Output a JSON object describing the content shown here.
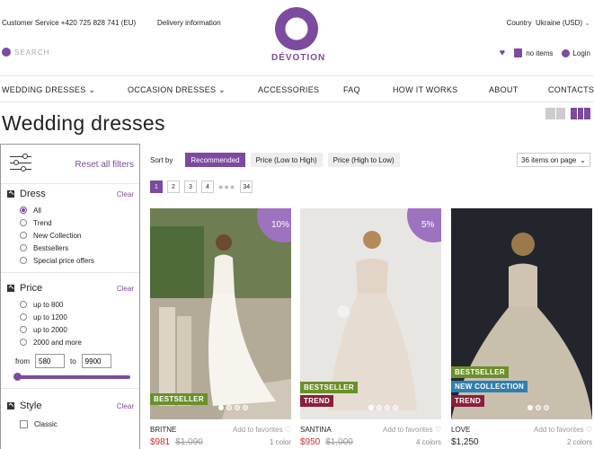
{
  "header": {
    "customer_service": "Customer Service  +420 725 828 741 (EU)",
    "delivery": "Delivery information",
    "logo_text": "DÉVOTION",
    "logo_letter": "D",
    "country_label": "Country",
    "country_value": "Ukraine (USD)",
    "search_placeholder": "SEARCH",
    "cart_label": "no items",
    "login_label": "Login"
  },
  "nav": [
    {
      "label": "WEDDING DRESSES"
    },
    {
      "label": "OCCASION DRESSES"
    },
    {
      "label": "ACCESSORIES"
    },
    {
      "label": "FAQ"
    },
    {
      "label": "HOW IT WORKS"
    },
    {
      "label": "ABOUT"
    },
    {
      "label": "CONTACTS"
    }
  ],
  "page_title": "Wedding dresses",
  "sidebar": {
    "reset": "Reset all filters",
    "dress": {
      "title": "Dress",
      "clear": "Clear",
      "options": [
        "All",
        "Trend",
        "New Collection",
        "Bestsellers",
        "Special price offers"
      ]
    },
    "price": {
      "title": "Price",
      "clear": "Clear",
      "options": [
        "up to 800",
        "up to 1200",
        "up to 2000",
        "2000 and more"
      ],
      "from_label": "from",
      "from_value": "580",
      "to_label": "to",
      "to_value": "9900"
    },
    "style": {
      "title": "Style",
      "clear": "Clear",
      "options": [
        "Classic"
      ]
    }
  },
  "sort": {
    "label": "Sort by",
    "options": [
      "Recommended",
      "Price (Low to High)",
      "Price (High to Low)"
    ],
    "per_page": "36 items on page"
  },
  "pagination": [
    "1",
    "2",
    "3",
    "4",
    "34"
  ],
  "products": [
    {
      "name": "BRITNE",
      "fav": "Add to favorites",
      "price": "$981",
      "old_price": "$1,090",
      "colors": "1 color",
      "discount": "10%",
      "badges": [
        "BESTSELLER"
      ]
    },
    {
      "name": "SANTINA",
      "fav": "Add to favorites",
      "price": "$950",
      "old_price": "$1,000",
      "colors": "4 colors",
      "discount": "5%",
      "badges": [
        "BESTSELLER",
        "TREND"
      ]
    },
    {
      "name": "LOVE",
      "fav": "Add to favorites",
      "price": "$1,250",
      "old_price": "",
      "colors": "2 colors",
      "discount": "",
      "badges": [
        "BESTSELLER",
        "NEW COLLECTION",
        "TREND"
      ]
    }
  ],
  "colors": {
    "accent": "#7c4a9e",
    "sale": "#d42b2b",
    "bestseller": "#6b8f2a",
    "trend": "#8a1f3a",
    "new": "#2f7eb0"
  }
}
